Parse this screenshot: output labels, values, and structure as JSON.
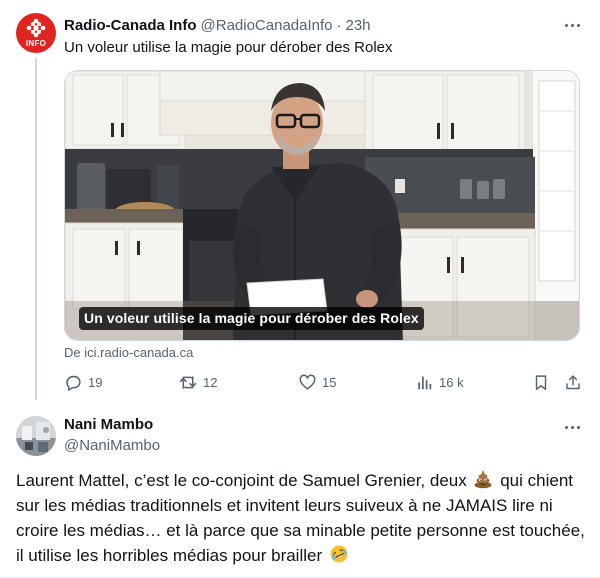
{
  "tweet1": {
    "author_name": "Radio-Canada Info",
    "handle": "@RadioCanadaInfo",
    "separator": "·",
    "time": "23h",
    "avatar_text": "INFO",
    "text": "Un voleur utilise la magie pour dérober des Rolex",
    "media_caption": "Un voleur utilise la magie pour dérober des Rolex",
    "source": "De ici.radio-canada.ca",
    "replies": "19",
    "reposts": "12",
    "likes": "15",
    "views": "16 k"
  },
  "tweet2": {
    "author_name": "Nani Mambo",
    "handle": "@NaniMambo",
    "text_line1": "Laurent Mattel, c’est le co-conjoint de Samuel Grenier, deux",
    "text_line1b": "qui chient",
    "text_line2": "sur les médias traditionnels et invitent leurs suiveux à ne JAMAIS lire ni",
    "text_line3": "croire les médias… et là parce que  sa minable petite personne est touchée,",
    "text_line4": "il utilise les horribles médias pour brailler"
  },
  "colors": {
    "text": "#0f1419",
    "secondary": "#536471",
    "brand_red": "#e0241f",
    "divider": "#cfd9de"
  },
  "icons": [
    "radio-canada-logo",
    "more-icon",
    "reply-icon",
    "repost-icon",
    "like-icon",
    "views-icon",
    "bookmark-icon",
    "share-icon",
    "poop-emoji",
    "rofl-emoji"
  ]
}
